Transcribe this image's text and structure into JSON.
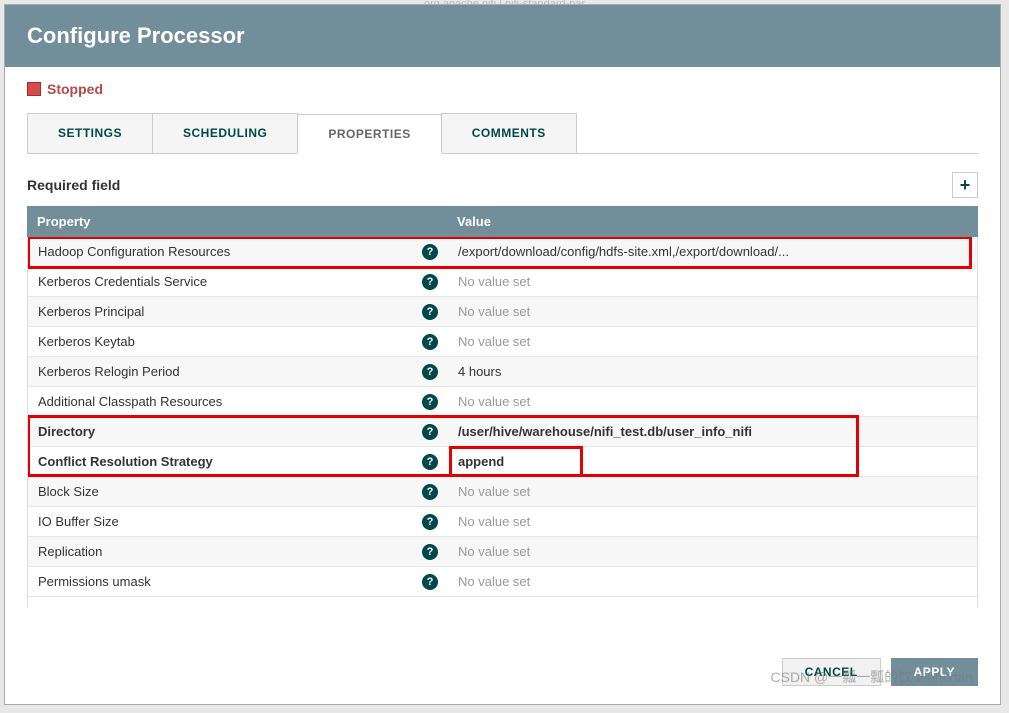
{
  "bg_text": "org.apache.nifi  |  nifi-standard-nar",
  "header": {
    "title": "Configure Processor"
  },
  "status": {
    "label": "Stopped"
  },
  "tabs": [
    {
      "label": "SETTINGS",
      "active": false
    },
    {
      "label": "SCHEDULING",
      "active": false
    },
    {
      "label": "PROPERTIES",
      "active": true
    },
    {
      "label": "COMMENTS",
      "active": false
    }
  ],
  "required_label": "Required field",
  "columns": {
    "property": "Property",
    "value": "Value"
  },
  "rows": [
    {
      "name": "Hadoop Configuration Resources",
      "bold": false,
      "value": "/export/download/config/hdfs-site.xml,/export/download/...",
      "novalue": false
    },
    {
      "name": "Kerberos Credentials Service",
      "bold": false,
      "value": "No value set",
      "novalue": true
    },
    {
      "name": "Kerberos Principal",
      "bold": false,
      "value": "No value set",
      "novalue": true
    },
    {
      "name": "Kerberos Keytab",
      "bold": false,
      "value": "No value set",
      "novalue": true
    },
    {
      "name": "Kerberos Relogin Period",
      "bold": false,
      "value": "4 hours",
      "novalue": false
    },
    {
      "name": "Additional Classpath Resources",
      "bold": false,
      "value": "No value set",
      "novalue": true
    },
    {
      "name": "Directory",
      "bold": true,
      "value": "/user/hive/warehouse/nifi_test.db/user_info_nifi",
      "novalue": false
    },
    {
      "name": "Conflict Resolution Strategy",
      "bold": true,
      "value": "append",
      "novalue": false
    },
    {
      "name": "Block Size",
      "bold": false,
      "value": "No value set",
      "novalue": true
    },
    {
      "name": "IO Buffer Size",
      "bold": false,
      "value": "No value set",
      "novalue": true
    },
    {
      "name": "Replication",
      "bold": false,
      "value": "No value set",
      "novalue": true
    },
    {
      "name": "Permissions umask",
      "bold": false,
      "value": "No value set",
      "novalue": true
    }
  ],
  "footer": {
    "cancel": "CANCEL",
    "apply": "APPLY"
  },
  "watermark": "CSDN @一瓢一瓢的饮 alanchan"
}
